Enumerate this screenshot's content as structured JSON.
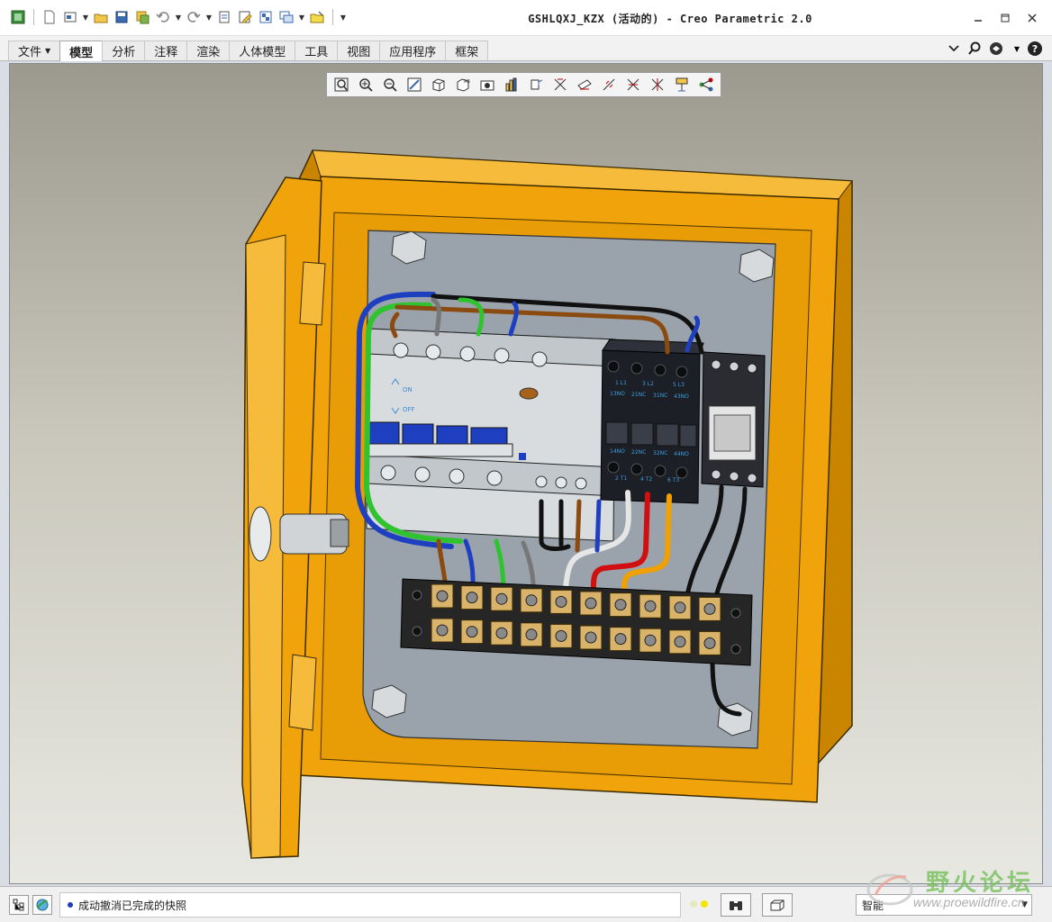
{
  "window": {
    "title": "GSHLQXJ_KZX (活动的) - Creo Parametric 2.0"
  },
  "quick_access": {
    "icons": [
      "window-icon",
      "new-icon",
      "regenerate-icon",
      "open-icon",
      "save-icon",
      "save-copy-icon",
      "undo-icon",
      "redo-icon",
      "regenerate-model-icon",
      "edit-icon",
      "windows-icon",
      "switch-window-icon",
      "close-icon",
      "customize-icon"
    ]
  },
  "ribbon": {
    "tabs": [
      {
        "label": "文件",
        "active": false,
        "has_menu": true
      },
      {
        "label": "模型",
        "active": true
      },
      {
        "label": "分析",
        "active": false
      },
      {
        "label": "注释",
        "active": false
      },
      {
        "label": "渲染",
        "active": false
      },
      {
        "label": "人体模型",
        "active": false
      },
      {
        "label": "工具",
        "active": false
      },
      {
        "label": "视图",
        "active": false
      },
      {
        "label": "应用程序",
        "active": false
      },
      {
        "label": "框架",
        "active": false
      }
    ]
  },
  "view_toolbar": {
    "buttons": [
      "refit-icon",
      "zoom-in-icon",
      "zoom-out-icon",
      "repaint-icon",
      "display-style-icon",
      "saved-orientations-icon",
      "view-manager-icon",
      "perspective-icon",
      "spin-center-icon",
      "datum-planes-icon",
      "datum-axes-icon",
      "datum-points-icon",
      "coordinate-systems-icon",
      "annotations-icon",
      "tags-icon",
      "network-icon"
    ]
  },
  "status": {
    "message": "成动撤消已完成的快照",
    "light_colors": [
      "#e8e8c0",
      "#f5e600"
    ],
    "filter_value": "智能"
  },
  "watermark": {
    "text": "野火论坛",
    "url": "www.proewildfire.cn"
  },
  "model": {
    "breaker_labels": [
      "ON",
      "OFF"
    ],
    "contactor_top_labels": [
      "1 L1",
      "3 L2",
      "5 L3"
    ],
    "contactor_mid_labels": [
      "13NO",
      "21NC",
      "31NC",
      "43NO"
    ],
    "contactor_low_labels": [
      "14NO",
      "22NC",
      "32NC",
      "44NO"
    ],
    "contactor_bottom_labels": [
      "2 T1",
      "4 T2",
      "6 T3"
    ],
    "colors": {
      "enclosure": "#f0a30a",
      "enclosure_dark": "#c97f00",
      "backplate": "#9aa3ab",
      "contactor": "#1d1f26",
      "breaker": "#d8dcdf",
      "terminal_block": "#262626",
      "terminal": "#d9b36a"
    }
  }
}
